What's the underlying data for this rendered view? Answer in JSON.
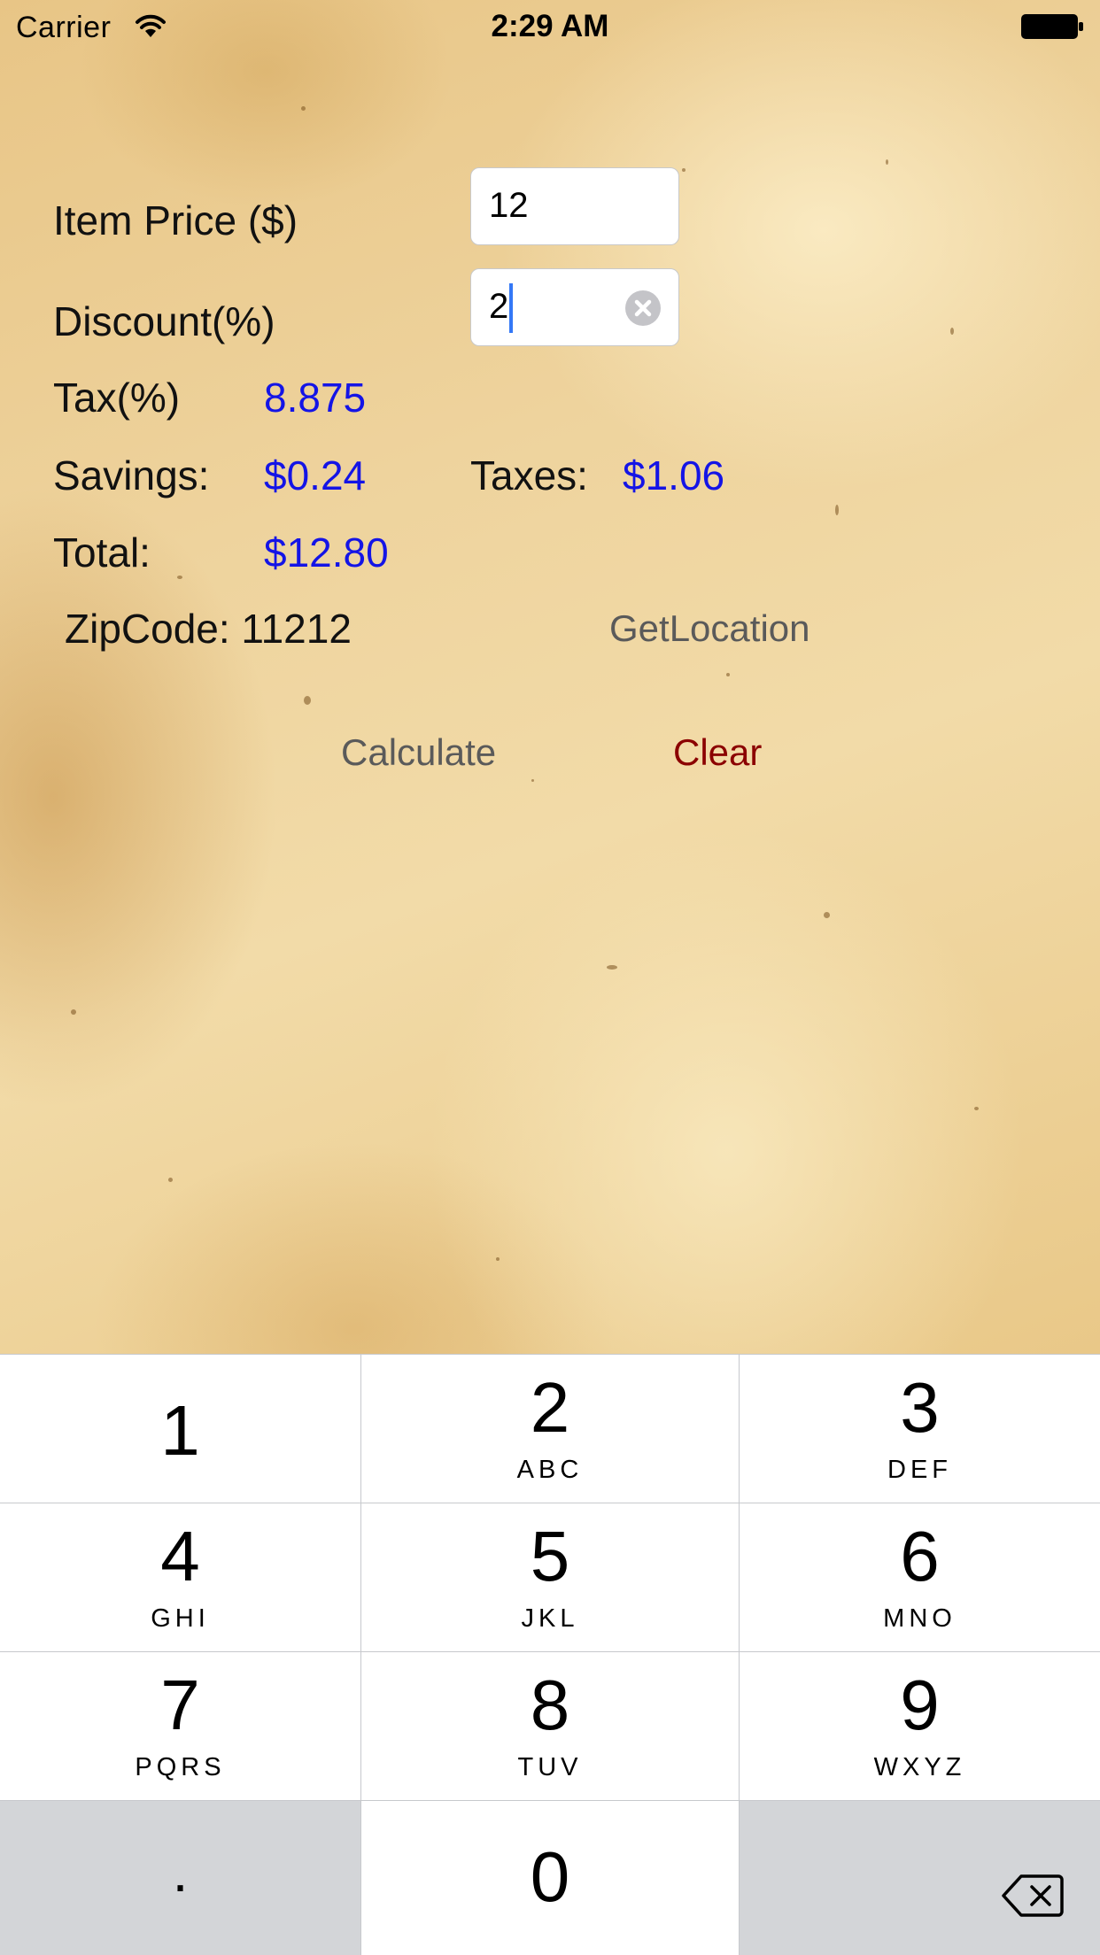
{
  "status_bar": {
    "carrier": "Carrier",
    "time": "2:29 AM",
    "icons": [
      "wifi-icon",
      "battery-icon"
    ]
  },
  "form": {
    "item_price_label": "Item Price ($)",
    "item_price_value": "12",
    "discount_label": "Discount(%)",
    "discount_value": "2",
    "tax_label": "Tax(%)",
    "tax_value": "8.875",
    "savings_label": "Savings:",
    "savings_value": "$0.24",
    "taxes_label": "Taxes:",
    "taxes_value": "$1.06",
    "total_label": "Total:",
    "total_value": "$12.80",
    "zipcode_label": "ZipCode: 11212"
  },
  "buttons": {
    "get_location": "GetLocation",
    "calculate": "Calculate",
    "clear": "Clear"
  },
  "keypad": {
    "keys": [
      {
        "digit": "1",
        "letters": ""
      },
      {
        "digit": "2",
        "letters": "ABC"
      },
      {
        "digit": "3",
        "letters": "DEF"
      },
      {
        "digit": "4",
        "letters": "GHI"
      },
      {
        "digit": "5",
        "letters": "JKL"
      },
      {
        "digit": "6",
        "letters": "MNO"
      },
      {
        "digit": "7",
        "letters": "PQRS"
      },
      {
        "digit": "8",
        "letters": "TUV"
      },
      {
        "digit": "9",
        "letters": "WXYZ"
      }
    ],
    "decimal": ".",
    "zero": "0",
    "backspace_icon": "backspace-icon"
  },
  "colors": {
    "value_blue": "#1414e6",
    "clear_red": "#8b0000",
    "button_gray": "#5a5a5a",
    "cursor_blue": "#3478f6"
  }
}
